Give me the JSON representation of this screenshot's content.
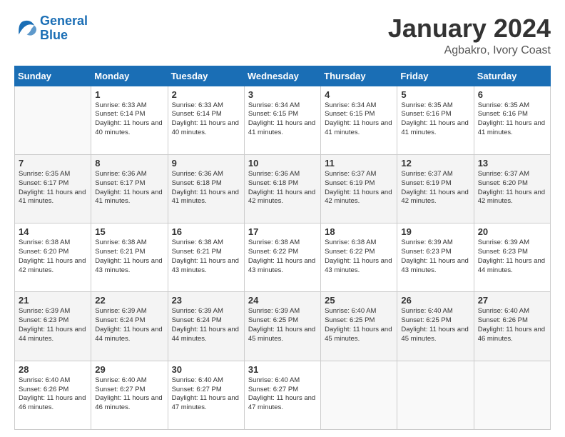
{
  "header": {
    "logo_general": "General",
    "logo_blue": "Blue",
    "month_title": "January 2024",
    "subtitle": "Agbakro, Ivory Coast"
  },
  "weekdays": [
    "Sunday",
    "Monday",
    "Tuesday",
    "Wednesday",
    "Thursday",
    "Friday",
    "Saturday"
  ],
  "weeks": [
    [
      {
        "day": "",
        "sunrise": "",
        "sunset": "",
        "daylight": ""
      },
      {
        "day": "1",
        "sunrise": "Sunrise: 6:33 AM",
        "sunset": "Sunset: 6:14 PM",
        "daylight": "Daylight: 11 hours and 40 minutes."
      },
      {
        "day": "2",
        "sunrise": "Sunrise: 6:33 AM",
        "sunset": "Sunset: 6:14 PM",
        "daylight": "Daylight: 11 hours and 40 minutes."
      },
      {
        "day": "3",
        "sunrise": "Sunrise: 6:34 AM",
        "sunset": "Sunset: 6:15 PM",
        "daylight": "Daylight: 11 hours and 41 minutes."
      },
      {
        "day": "4",
        "sunrise": "Sunrise: 6:34 AM",
        "sunset": "Sunset: 6:15 PM",
        "daylight": "Daylight: 11 hours and 41 minutes."
      },
      {
        "day": "5",
        "sunrise": "Sunrise: 6:35 AM",
        "sunset": "Sunset: 6:16 PM",
        "daylight": "Daylight: 11 hours and 41 minutes."
      },
      {
        "day": "6",
        "sunrise": "Sunrise: 6:35 AM",
        "sunset": "Sunset: 6:16 PM",
        "daylight": "Daylight: 11 hours and 41 minutes."
      }
    ],
    [
      {
        "day": "7",
        "sunrise": "Sunrise: 6:35 AM",
        "sunset": "Sunset: 6:17 PM",
        "daylight": "Daylight: 11 hours and 41 minutes."
      },
      {
        "day": "8",
        "sunrise": "Sunrise: 6:36 AM",
        "sunset": "Sunset: 6:17 PM",
        "daylight": "Daylight: 11 hours and 41 minutes."
      },
      {
        "day": "9",
        "sunrise": "Sunrise: 6:36 AM",
        "sunset": "Sunset: 6:18 PM",
        "daylight": "Daylight: 11 hours and 41 minutes."
      },
      {
        "day": "10",
        "sunrise": "Sunrise: 6:36 AM",
        "sunset": "Sunset: 6:18 PM",
        "daylight": "Daylight: 11 hours and 42 minutes."
      },
      {
        "day": "11",
        "sunrise": "Sunrise: 6:37 AM",
        "sunset": "Sunset: 6:19 PM",
        "daylight": "Daylight: 11 hours and 42 minutes."
      },
      {
        "day": "12",
        "sunrise": "Sunrise: 6:37 AM",
        "sunset": "Sunset: 6:19 PM",
        "daylight": "Daylight: 11 hours and 42 minutes."
      },
      {
        "day": "13",
        "sunrise": "Sunrise: 6:37 AM",
        "sunset": "Sunset: 6:20 PM",
        "daylight": "Daylight: 11 hours and 42 minutes."
      }
    ],
    [
      {
        "day": "14",
        "sunrise": "Sunrise: 6:38 AM",
        "sunset": "Sunset: 6:20 PM",
        "daylight": "Daylight: 11 hours and 42 minutes."
      },
      {
        "day": "15",
        "sunrise": "Sunrise: 6:38 AM",
        "sunset": "Sunset: 6:21 PM",
        "daylight": "Daylight: 11 hours and 43 minutes."
      },
      {
        "day": "16",
        "sunrise": "Sunrise: 6:38 AM",
        "sunset": "Sunset: 6:21 PM",
        "daylight": "Daylight: 11 hours and 43 minutes."
      },
      {
        "day": "17",
        "sunrise": "Sunrise: 6:38 AM",
        "sunset": "Sunset: 6:22 PM",
        "daylight": "Daylight: 11 hours and 43 minutes."
      },
      {
        "day": "18",
        "sunrise": "Sunrise: 6:38 AM",
        "sunset": "Sunset: 6:22 PM",
        "daylight": "Daylight: 11 hours and 43 minutes."
      },
      {
        "day": "19",
        "sunrise": "Sunrise: 6:39 AM",
        "sunset": "Sunset: 6:23 PM",
        "daylight": "Daylight: 11 hours and 43 minutes."
      },
      {
        "day": "20",
        "sunrise": "Sunrise: 6:39 AM",
        "sunset": "Sunset: 6:23 PM",
        "daylight": "Daylight: 11 hours and 44 minutes."
      }
    ],
    [
      {
        "day": "21",
        "sunrise": "Sunrise: 6:39 AM",
        "sunset": "Sunset: 6:23 PM",
        "daylight": "Daylight: 11 hours and 44 minutes."
      },
      {
        "day": "22",
        "sunrise": "Sunrise: 6:39 AM",
        "sunset": "Sunset: 6:24 PM",
        "daylight": "Daylight: 11 hours and 44 minutes."
      },
      {
        "day": "23",
        "sunrise": "Sunrise: 6:39 AM",
        "sunset": "Sunset: 6:24 PM",
        "daylight": "Daylight: 11 hours and 44 minutes."
      },
      {
        "day": "24",
        "sunrise": "Sunrise: 6:39 AM",
        "sunset": "Sunset: 6:25 PM",
        "daylight": "Daylight: 11 hours and 45 minutes."
      },
      {
        "day": "25",
        "sunrise": "Sunrise: 6:40 AM",
        "sunset": "Sunset: 6:25 PM",
        "daylight": "Daylight: 11 hours and 45 minutes."
      },
      {
        "day": "26",
        "sunrise": "Sunrise: 6:40 AM",
        "sunset": "Sunset: 6:25 PM",
        "daylight": "Daylight: 11 hours and 45 minutes."
      },
      {
        "day": "27",
        "sunrise": "Sunrise: 6:40 AM",
        "sunset": "Sunset: 6:26 PM",
        "daylight": "Daylight: 11 hours and 46 minutes."
      }
    ],
    [
      {
        "day": "28",
        "sunrise": "Sunrise: 6:40 AM",
        "sunset": "Sunset: 6:26 PM",
        "daylight": "Daylight: 11 hours and 46 minutes."
      },
      {
        "day": "29",
        "sunrise": "Sunrise: 6:40 AM",
        "sunset": "Sunset: 6:27 PM",
        "daylight": "Daylight: 11 hours and 46 minutes."
      },
      {
        "day": "30",
        "sunrise": "Sunrise: 6:40 AM",
        "sunset": "Sunset: 6:27 PM",
        "daylight": "Daylight: 11 hours and 47 minutes."
      },
      {
        "day": "31",
        "sunrise": "Sunrise: 6:40 AM",
        "sunset": "Sunset: 6:27 PM",
        "daylight": "Daylight: 11 hours and 47 minutes."
      },
      {
        "day": "",
        "sunrise": "",
        "sunset": "",
        "daylight": ""
      },
      {
        "day": "",
        "sunrise": "",
        "sunset": "",
        "daylight": ""
      },
      {
        "day": "",
        "sunrise": "",
        "sunset": "",
        "daylight": ""
      }
    ]
  ]
}
